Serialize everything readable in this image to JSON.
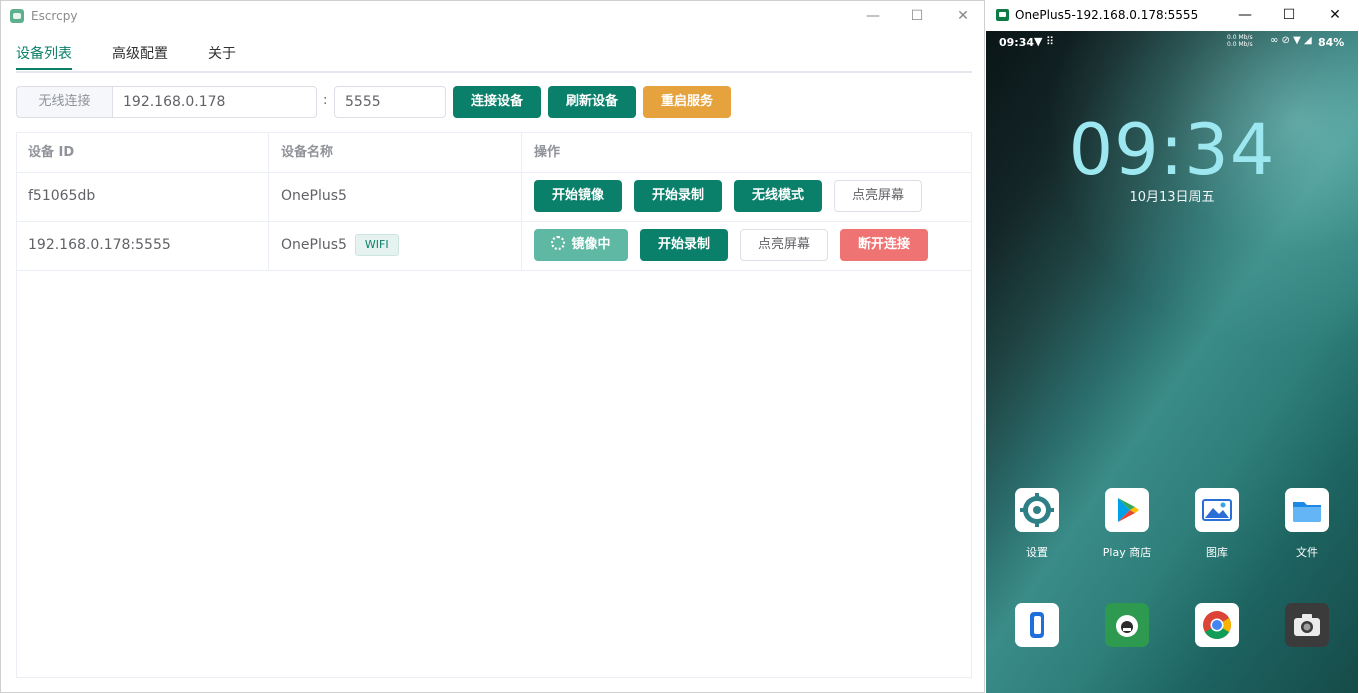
{
  "left_window": {
    "title": "Escrcpy",
    "controls": {
      "minimize": "—",
      "maximize": "☐",
      "close": "✕"
    },
    "tabs": [
      {
        "label": "设备列表",
        "active": true
      },
      {
        "label": "高级配置",
        "active": false
      },
      {
        "label": "关于",
        "active": false
      }
    ],
    "connect": {
      "prefix": "无线连接",
      "ip_value": "192.168.0.178",
      "separator": ":",
      "port_value": "5555",
      "buttons": {
        "connect": "连接设备",
        "refresh": "刷新设备",
        "restart": "重启服务"
      }
    },
    "table": {
      "headers": {
        "id": "设备 ID",
        "name": "设备名称",
        "actions": "操作"
      },
      "rows": [
        {
          "id": "f51065db",
          "name": "OnePlus5",
          "tag": "",
          "actions": {
            "a1": "开始镜像",
            "a2": "开始录制",
            "a3": "无线模式",
            "a4": "点亮屏幕"
          }
        },
        {
          "id": "192.168.0.178:5555",
          "name": "OnePlus5",
          "tag": "WIFI",
          "actions": {
            "a1": "镜像中",
            "a2": "开始录制",
            "a3": "点亮屏幕",
            "a4": "断开连接"
          }
        }
      ]
    },
    "colors": {
      "primary": "#0a7f6a",
      "warning": "#e6a23c",
      "danger": "#f07373"
    }
  },
  "right_window": {
    "title": "OnePlus5-192.168.0.178:5555",
    "controls": {
      "minimize": "—",
      "maximize": "☐",
      "close": "✕"
    },
    "phone": {
      "status_time": "09:34",
      "status_speed_1": "0.0 Mb/s",
      "status_speed_2": "0.0 Mb/s",
      "battery": "84%",
      "clock": "09:34",
      "date": "10月13日周五",
      "apps_row1": [
        {
          "label": "设置",
          "icon": "settings-icon"
        },
        {
          "label": "Play 商店",
          "icon": "play-store-icon"
        },
        {
          "label": "图库",
          "icon": "gallery-icon"
        },
        {
          "label": "文件",
          "icon": "files-icon"
        }
      ],
      "apps_row2": [
        {
          "icon": "phone-icon"
        },
        {
          "icon": "messaging-icon"
        },
        {
          "icon": "chrome-icon"
        },
        {
          "icon": "camera-icon"
        }
      ]
    }
  }
}
